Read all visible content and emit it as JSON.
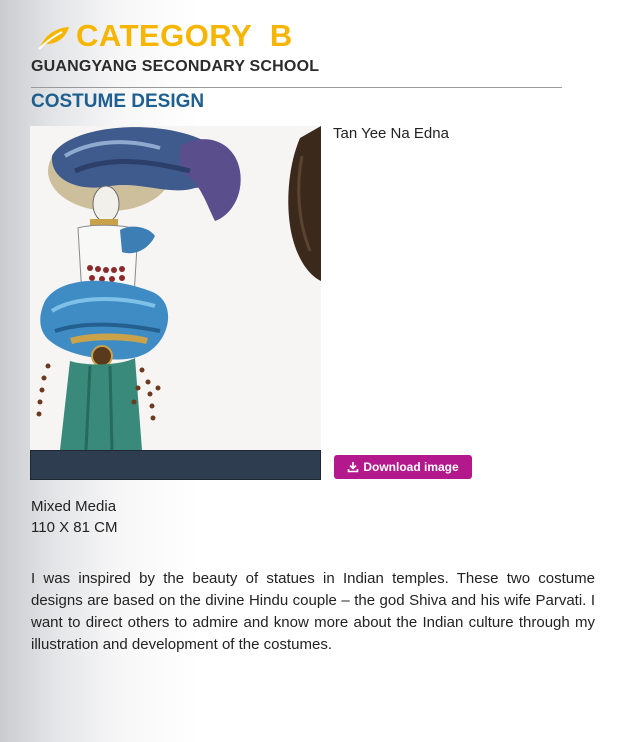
{
  "header": {
    "category": "CATEGORY  B",
    "school": "GUANGYANG SECONDARY SCHOOL",
    "section": "COSTUME DESIGN"
  },
  "artwork": {
    "artist": "Tan Yee Na Edna",
    "download_label": "Download image",
    "medium": "Mixed Media",
    "dimensions": "110 X 81 CM"
  },
  "description": "I was inspired by the beauty of statues in Indian temples. These two costume designs are based on the divine Hindu couple – the god Shiva and his wife Parvati. I want to direct others to admire and know more about the Indian culture through my illustration and development of the costumes.",
  "colors": {
    "accent": "#f5b500",
    "section": "#1f5f8f",
    "button": "#b3188c"
  },
  "icons": {
    "leaf": "leaf-icon",
    "download": "download-icon"
  }
}
